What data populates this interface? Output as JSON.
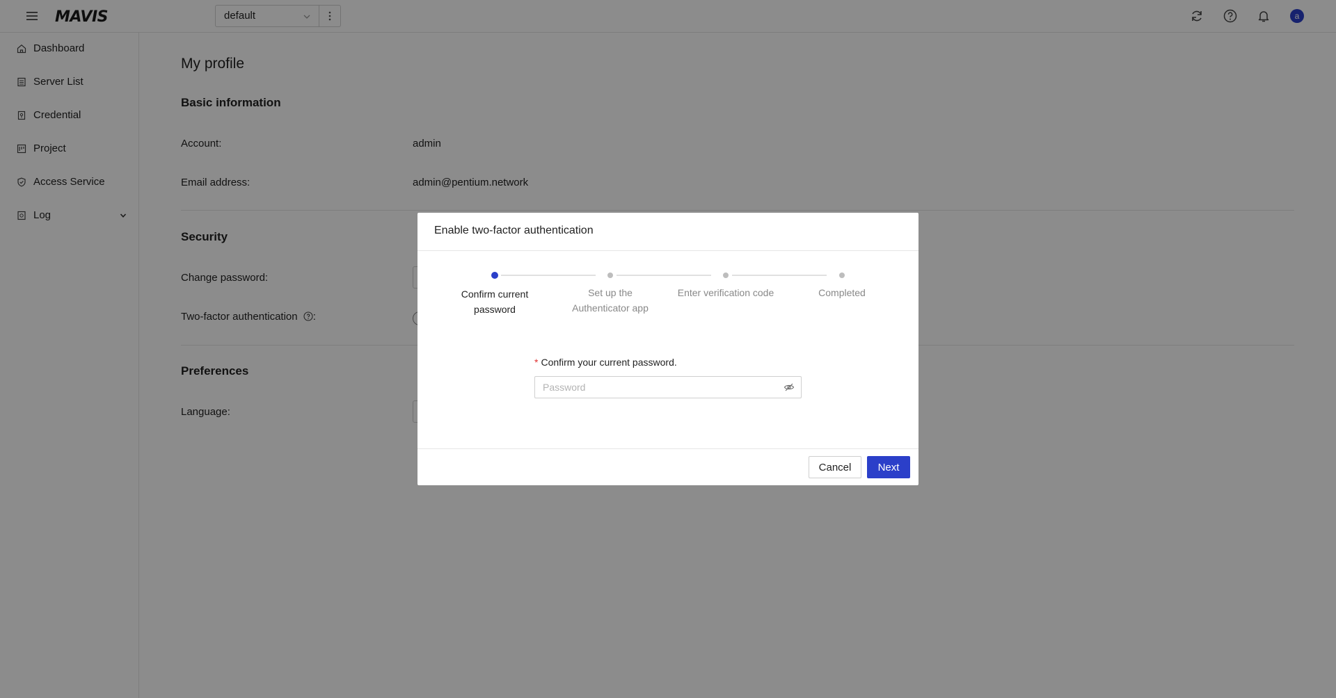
{
  "header": {
    "logo_text": "MAVIS",
    "project_selector": {
      "value": "default"
    }
  },
  "sidebar": {
    "items": [
      {
        "label": "Dashboard",
        "icon": "home-icon"
      },
      {
        "label": "Server List",
        "icon": "server-list-icon"
      },
      {
        "label": "Credential",
        "icon": "credential-icon"
      },
      {
        "label": "Project",
        "icon": "project-icon"
      },
      {
        "label": "Access Service",
        "icon": "shield-check-icon"
      },
      {
        "label": "Log",
        "icon": "log-icon",
        "expandable": true
      }
    ]
  },
  "main": {
    "page_title": "My profile",
    "basic_info": {
      "title": "Basic information",
      "account_label": "Account",
      "account_value": "admin",
      "email_label": "Email address",
      "email_value": "admin@pentium.network"
    },
    "security": {
      "title": "Security",
      "change_password_label": "Change password",
      "two_factor_label": "Two-factor authentication"
    },
    "preferences": {
      "title": "Preferences",
      "language_label": "Language"
    },
    "colon": ":"
  },
  "modal": {
    "title": "Enable two-factor authentication",
    "steps": [
      {
        "label": "Confirm current password",
        "state": "active"
      },
      {
        "label": "Set up the Authenticator app",
        "state": "pending"
      },
      {
        "label": "Enter verification code",
        "state": "pending"
      },
      {
        "label": "Completed",
        "state": "pending"
      }
    ],
    "password_field": {
      "required_marker": "*",
      "label": "Confirm your current password.",
      "placeholder": "Password",
      "value": ""
    },
    "cancel_label": "Cancel",
    "next_label": "Next"
  },
  "colors": {
    "primary": "#2b3fc9",
    "required": "#e03131",
    "overlay": "rgba(0,0,0,0.45)"
  }
}
